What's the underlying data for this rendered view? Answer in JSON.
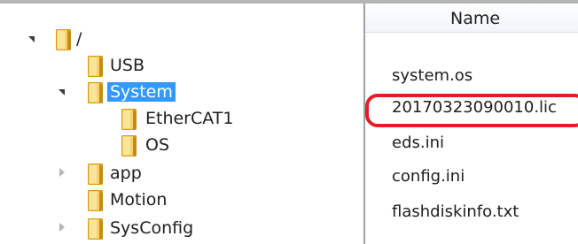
{
  "tree": {
    "root": {
      "label": "/",
      "expanded": true
    },
    "items": [
      {
        "label": "USB"
      },
      {
        "label": "System",
        "expanded": true,
        "selected": true
      },
      {
        "label": "EtherCAT1"
      },
      {
        "label": "OS"
      },
      {
        "label": "app",
        "expanded": false
      },
      {
        "label": "Motion"
      },
      {
        "label": "SysConfig",
        "expanded": false
      }
    ]
  },
  "file_list": {
    "column_header": "Name",
    "files": [
      "system.os",
      "20170323090010.lic",
      "eds.ini",
      "config.ini",
      "flashdiskinfo.txt"
    ],
    "highlighted_file": "20170323090010.lic",
    "highlight_color": "#e21d2a"
  },
  "colors": {
    "selection": "#3399ff",
    "folder": "#e8b93a"
  }
}
